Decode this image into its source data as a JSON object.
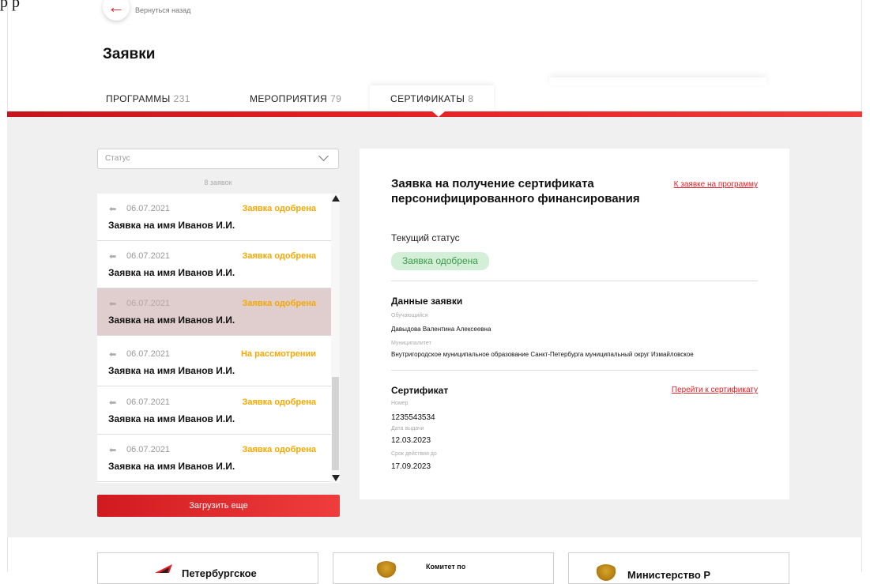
{
  "header": {
    "stray_top_text": "р р",
    "back_label": "Вернуться назад",
    "page_title": "Заявки"
  },
  "tabs": [
    {
      "label": "ПРОГРАММЫ",
      "count": "231"
    },
    {
      "label": "МЕРОПРИЯТИЯ",
      "count": "79"
    },
    {
      "label": "СЕРТИФИКАТЫ",
      "count": "8"
    }
  ],
  "filter": {
    "status_placeholder": "Статус",
    "count_label": "8 заявок"
  },
  "list_items": [
    {
      "date": "06.07.2021",
      "status": "Заявка одобрена",
      "name": "Заявка на имя Иванов И.И."
    },
    {
      "date": "06.07.2021",
      "status": "Заявка одобрена",
      "name": "Заявка на имя Иванов И.И."
    },
    {
      "date": "06.07.2021",
      "status": "Заявка одобрена",
      "name": "Заявка на имя Иванов И.И."
    },
    {
      "date": "06.07.2021",
      "status": "На рассмотрении",
      "name": "Заявка на имя Иванов И.И."
    },
    {
      "date": "06.07.2021",
      "status": "Заявка одобрена",
      "name": "Заявка на имя Иванов И.И."
    },
    {
      "date": "06.07.2021",
      "status": "Заявка одобрена",
      "name": "Заявка на имя Иванов И.И."
    }
  ],
  "load_more_label": "Загрузить еще",
  "detail": {
    "title": "Заявка на получение сертификата персонифицированного финансирования",
    "program_link": "К заявке на программу",
    "current_status_label": "Текущий статус",
    "status_badge": "Заявка одобрена",
    "data_section_title": "Данные заявки",
    "student_label": "Обучающийся",
    "student_value": "Давыдова Валентина Алексеевна",
    "municipality_label": "Муниципалитет",
    "municipality_value": "Внутригородское муниципальное образование Санкт-Петербурга муниципальный округ Измайловское",
    "certificate_section_title": "Сертификат",
    "certificate_link": "Перейти к сертификату",
    "number_label": "Номер",
    "number_value": "1235543534",
    "issue_date_label": "Дата выдачи",
    "issue_date_value": "12.03.2023",
    "valid_until_label": "Срок действия до",
    "valid_until_value": "17.09.2023"
  },
  "footer": {
    "card1_text": "Петербургское",
    "card2_text": "Комитет по",
    "card3_text": "Министерство Р"
  },
  "colors": {
    "accent_red": "#e31e24",
    "approved_orange": "#f5a800",
    "badge_green_bg": "#d3efd7",
    "badge_green_text": "#3a9a4a",
    "selected_row": "#e0cece"
  }
}
